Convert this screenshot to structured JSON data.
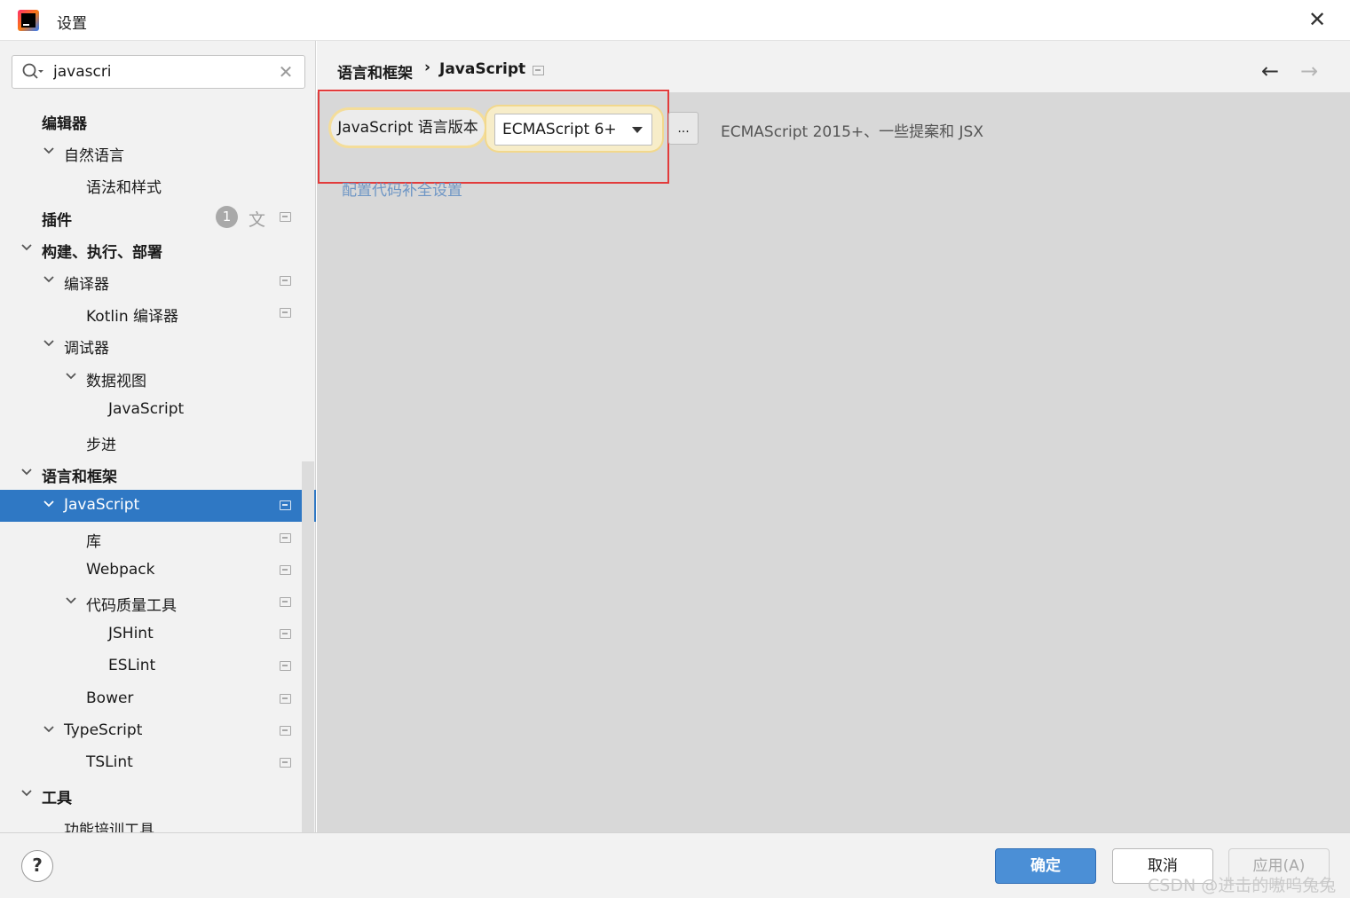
{
  "window": {
    "title": "设置"
  },
  "search": {
    "value": "javascri"
  },
  "tree": [
    {
      "label": "编辑器",
      "level": 0,
      "bold": true,
      "chevron": false
    },
    {
      "label": "自然语言",
      "level": 1,
      "bold": false,
      "chevron": true
    },
    {
      "label": "语法和样式",
      "level": 2,
      "bold": false,
      "chevron": false
    },
    {
      "label": "插件",
      "level": 0,
      "bold": true,
      "chevron": false,
      "badge": "1",
      "translate": true,
      "gear": true
    },
    {
      "label": "构建、执行、部署",
      "level": 0,
      "bold": true,
      "chevron": true
    },
    {
      "label": "编译器",
      "level": 1,
      "bold": false,
      "chevron": true,
      "gear": true
    },
    {
      "label": "Kotlin 编译器",
      "level": 2,
      "bold": false,
      "chevron": false,
      "gear": true
    },
    {
      "label": "调试器",
      "level": 1,
      "bold": false,
      "chevron": true
    },
    {
      "label": "数据视图",
      "level": 2,
      "bold": false,
      "chevron": true
    },
    {
      "label": "JavaScript",
      "level": 3,
      "bold": false,
      "chevron": false
    },
    {
      "label": "步进",
      "level": 2,
      "bold": false,
      "chevron": false
    },
    {
      "label": "语言和框架",
      "level": 0,
      "bold": true,
      "chevron": true
    },
    {
      "label": "JavaScript",
      "level": 1,
      "bold": false,
      "chevron": true,
      "gear": true,
      "selected": true
    },
    {
      "label": "库",
      "level": 2,
      "bold": false,
      "chevron": false,
      "gear": true
    },
    {
      "label": "Webpack",
      "level": 2,
      "bold": false,
      "chevron": false,
      "gear": true
    },
    {
      "label": "代码质量工具",
      "level": 2,
      "bold": false,
      "chevron": true,
      "gear": true
    },
    {
      "label": "JSHint",
      "level": 3,
      "bold": false,
      "chevron": false,
      "gear": true
    },
    {
      "label": "ESLint",
      "level": 3,
      "bold": false,
      "chevron": false,
      "gear": true
    },
    {
      "label": "Bower",
      "level": 2,
      "bold": false,
      "chevron": false,
      "gear": true
    },
    {
      "label": "TypeScript",
      "level": 1,
      "bold": false,
      "chevron": true,
      "gear": true
    },
    {
      "label": "TSLint",
      "level": 2,
      "bold": false,
      "chevron": false,
      "gear": true
    },
    {
      "label": "工具",
      "level": 0,
      "bold": true,
      "chevron": true
    },
    {
      "label": "功能培训工具",
      "level": 1,
      "bold": false,
      "chevron": false
    }
  ],
  "breadcrumb": {
    "parent": "语言和框架",
    "separator": "›",
    "current": "JavaScript"
  },
  "settings": {
    "lang_version_label": "JavaScript 语言版本",
    "lang_version_value": "ECMAScript 6+",
    "more_label": "...",
    "description": "ECMAScript 2015+、一些提案和 JSX",
    "config_link": "配置代码补全设置"
  },
  "footer": {
    "help": "?",
    "ok": "确定",
    "cancel": "取消",
    "apply": "应用(A)",
    "watermark": "CSDN @进击的嗷呜兔兔"
  },
  "colors": {
    "selection": "#2f78c4",
    "primary_button": "#4b8fd6",
    "highlight_border": "#e23b3b",
    "link": "#6e96c5"
  }
}
